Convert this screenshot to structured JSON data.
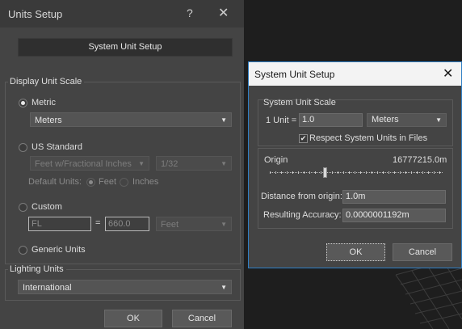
{
  "units_setup": {
    "title": "Units Setup",
    "help_glyph": "?",
    "close_glyph": "✕",
    "system_unit_setup_button": "System Unit Setup",
    "display_unit_scale": {
      "label": "Display Unit Scale",
      "metric": {
        "label": "Metric",
        "checked": true,
        "dropdown": "Meters"
      },
      "us_standard": {
        "label": "US Standard",
        "dropdown_units": "Feet w/Fractional Inches",
        "dropdown_fraction": "1/32",
        "default_units_label": "Default Units:",
        "feet_label": "Feet",
        "inches_label": "Inches"
      },
      "custom": {
        "label": "Custom",
        "name_value": "FL",
        "equals": "=",
        "amount_value": "660.0",
        "unit_dropdown": "Feet"
      },
      "generic": {
        "label": "Generic Units"
      }
    },
    "lighting_units": {
      "label": "Lighting Units",
      "dropdown": "International"
    },
    "ok_label": "OK",
    "cancel_label": "Cancel"
  },
  "system_unit_setup": {
    "title": "System Unit Setup",
    "close_glyph": "✕",
    "scale_label": "System Unit Scale",
    "unit_prefix": "1 Unit =",
    "unit_value": "1.0",
    "unit_dropdown": "Meters",
    "respect_label": "Respect System Units in Files",
    "respect_checked": true,
    "origin_label": "Origin",
    "origin_value": "16777215.0m",
    "distance_label": "Distance from origin:",
    "distance_value": "1.0m",
    "accuracy_label": "Resulting Accuracy:",
    "accuracy_value": "0.0000001192m",
    "ok_label": "OK",
    "cancel_label": "Cancel"
  },
  "icons": {
    "caret": "▼",
    "check": "✔"
  }
}
